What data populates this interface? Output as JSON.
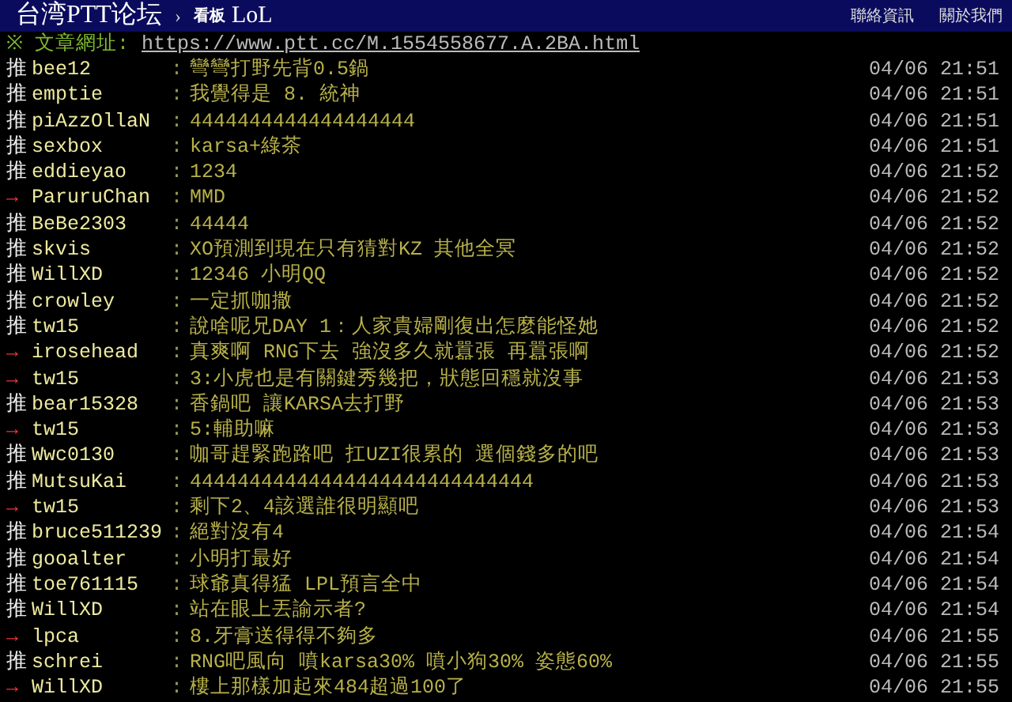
{
  "header": {
    "site": "台湾PTT论坛",
    "separator": "›",
    "board_label": "看板",
    "board": "LoL",
    "links": [
      "聯絡資訊",
      "關於我們"
    ]
  },
  "url_line": {
    "mark": "※",
    "label": "文章網址:",
    "url": "https://www.ptt.cc/M.1554558677.A.2BA.html"
  },
  "comments": [
    {
      "kind": "push",
      "tag": "推",
      "user": "bee12",
      "sep": ":",
      "text": "彎彎打野先背0.5鍋",
      "time": "04/06 21:51"
    },
    {
      "kind": "push",
      "tag": "推",
      "user": "emptie",
      "sep": ":",
      "text": "我覺得是 8. 統神",
      "time": "04/06 21:51"
    },
    {
      "kind": "push",
      "tag": "推",
      "user": "piAzzOllaN",
      "sep": ":",
      "text": "4444444444444444444",
      "time": "04/06 21:51"
    },
    {
      "kind": "push",
      "tag": "推",
      "user": "sexbox",
      "sep": ":",
      "text": "karsa+綠茶",
      "time": "04/06 21:51"
    },
    {
      "kind": "push",
      "tag": "推",
      "user": "eddieyao",
      "sep": ":",
      "text": "1234",
      "time": "04/06 21:52"
    },
    {
      "kind": "arrow",
      "tag": "→",
      "user": "ParuruChan",
      "sep": ":",
      "text": "MMD",
      "time": "04/06 21:52"
    },
    {
      "kind": "push",
      "tag": "推",
      "user": "BeBe2303",
      "sep": ":",
      "text": "44444",
      "time": "04/06 21:52"
    },
    {
      "kind": "push",
      "tag": "推",
      "user": "skvis",
      "sep": ":",
      "text": "XO預測到現在只有猜對KZ 其他全冥",
      "time": "04/06 21:52"
    },
    {
      "kind": "push",
      "tag": "推",
      "user": "WillXD",
      "sep": ":",
      "text": "12346 小明QQ",
      "time": "04/06 21:52"
    },
    {
      "kind": "push",
      "tag": "推",
      "user": "crowley",
      "sep": ":",
      "text": "一定抓咖撒",
      "time": "04/06 21:52"
    },
    {
      "kind": "push",
      "tag": "推",
      "user": "tw15",
      "sep": ":",
      "text": "說啥呢兄DAY 1：人家貴婦剛復出怎麼能怪她",
      "time": "04/06 21:52"
    },
    {
      "kind": "arrow",
      "tag": "→",
      "user": "irosehead",
      "sep": ":",
      "text": "真爽啊 RNG下去 強沒多久就囂張 再囂張啊",
      "time": "04/06 21:52"
    },
    {
      "kind": "arrow",
      "tag": "→",
      "user": "tw15",
      "sep": ":",
      "text": "3:小虎也是有關鍵秀幾把，狀態回穩就沒事",
      "time": "04/06 21:53"
    },
    {
      "kind": "push",
      "tag": "推",
      "user": "bear15328",
      "sep": ":",
      "text": "香鍋吧  讓KARSA去打野",
      "time": "04/06 21:53"
    },
    {
      "kind": "arrow",
      "tag": "→",
      "user": "tw15",
      "sep": ":",
      "text": "5:輔助嘛",
      "time": "04/06 21:53"
    },
    {
      "kind": "push",
      "tag": "推",
      "user": "Wwc0130",
      "sep": ":",
      "text": "咖哥趕緊跑路吧 扛UZI很累的 選個錢多的吧",
      "time": "04/06 21:53"
    },
    {
      "kind": "push",
      "tag": "推",
      "user": "MutsuKai",
      "sep": ":",
      "text": "44444444444444444444444444444",
      "time": "04/06 21:53"
    },
    {
      "kind": "arrow",
      "tag": "→",
      "user": "tw15",
      "sep": ":",
      "text": "剩下2、4該選誰很明顯吧",
      "time": "04/06 21:53"
    },
    {
      "kind": "push",
      "tag": "推",
      "user": "bruce511239",
      "sep": ":",
      "text": "絕對沒有4",
      "time": "04/06 21:54"
    },
    {
      "kind": "push",
      "tag": "推",
      "user": "gooalter",
      "sep": ":",
      "text": "小明打最好",
      "time": "04/06 21:54"
    },
    {
      "kind": "push",
      "tag": "推",
      "user": "toe761115",
      "sep": ":",
      "text": "球爺真得猛 LPL預言全中",
      "time": "04/06 21:54"
    },
    {
      "kind": "push",
      "tag": "推",
      "user": "WillXD",
      "sep": ":",
      "text": "站在眼上丟諭示者?",
      "time": "04/06 21:54"
    },
    {
      "kind": "arrow",
      "tag": "→",
      "user": "lpca",
      "sep": ":",
      "text": "8.牙膏送得得不夠多",
      "time": "04/06 21:55"
    },
    {
      "kind": "push",
      "tag": "推",
      "user": "schrei",
      "sep": ":",
      "text": "RNG吧風向 噴karsa30% 噴小狗30% 姿態60%",
      "time": "04/06 21:55"
    },
    {
      "kind": "arrow",
      "tag": "→",
      "user": "WillXD",
      "sep": ":",
      "text": "樓上那樣加起來484超過100了",
      "time": "04/06 21:55"
    }
  ]
}
